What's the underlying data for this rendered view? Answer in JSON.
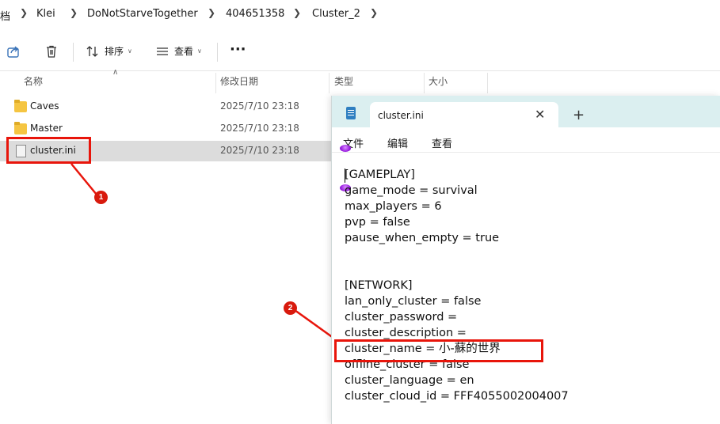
{
  "breadcrumb": {
    "items": [
      "档",
      "Klei",
      "DoNotStarveTogether",
      "404651358",
      "Cluster_2"
    ]
  },
  "toolbar": {
    "sort_label": "排序",
    "view_label": "查看",
    "more_label": "···"
  },
  "columns": {
    "name": "名称",
    "date": "修改日期",
    "type": "类型",
    "size": "大小"
  },
  "files": [
    {
      "name": "Caves",
      "date": "2025/7/10 23:18",
      "icon": "folder-icon"
    },
    {
      "name": "Master",
      "date": "2025/7/10 23:18",
      "icon": "folder-icon"
    },
    {
      "name": "cluster.ini",
      "date": "2025/7/10 23:18",
      "icon": "ini-file-icon"
    }
  ],
  "annotations": {
    "badge1": "1",
    "badge2": "2"
  },
  "notepad": {
    "tab_title": "cluster.ini",
    "close_glyph": "✕",
    "new_tab_glyph": "+",
    "menu": {
      "file": "文件",
      "edit": "编辑",
      "view": "查看"
    },
    "lines": [
      "[GAMEPLAY]",
      "game_mode = survival",
      "max_players = 6",
      "pvp = false",
      "pause_when_empty = true",
      "",
      "",
      "[NETWORK]",
      "lan_only_cluster = false",
      "cluster_password = ",
      "cluster_description = ",
      "cluster_name = 小-蘇的世界",
      "offline_cluster = false",
      "cluster_language = en",
      "cluster_cloud_id = FFF4055002004007"
    ]
  },
  "colors": {
    "annotation_red": "#e8150b",
    "notepad_titlebar": "#dbeff0",
    "selected_row": "#dcdcdc"
  }
}
